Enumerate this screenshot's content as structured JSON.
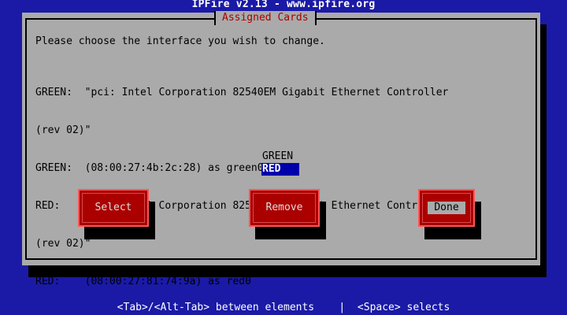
{
  "screen": {
    "title": "IPFire v2.13 - www.ipfire.org",
    "help_text": "<Tab>/<Alt-Tab> between elements    |  <Space> selects"
  },
  "dialog": {
    "title": "Assigned Cards",
    "prompt": "Please choose the interface you wish to change.",
    "info_lines": [
      "GREEN:  \"pci: Intel Corporation 82540EM Gigabit Ethernet Controller",
      "(rev 02)\"",
      "GREEN:  (08:00:27:4b:2c:28) as green0",
      "RED:    \"pci: Intel Corporation 82540EM Gigabit Ethernet Controller",
      "(rev 02)\"",
      "RED:    (08:00:27:81:74:9a) as red0"
    ],
    "list_items": [
      "GREEN",
      "RED"
    ],
    "selected_item": "RED",
    "buttons": {
      "select": "Select",
      "remove": "Remove",
      "done": "Done"
    }
  },
  "colors": {
    "screen_background": "#1a1aa6",
    "dialog_background": "#aaaaaa",
    "dialog_title": "#aa0000",
    "button_background": "#aa0000",
    "selection_background": "#0000aa"
  }
}
